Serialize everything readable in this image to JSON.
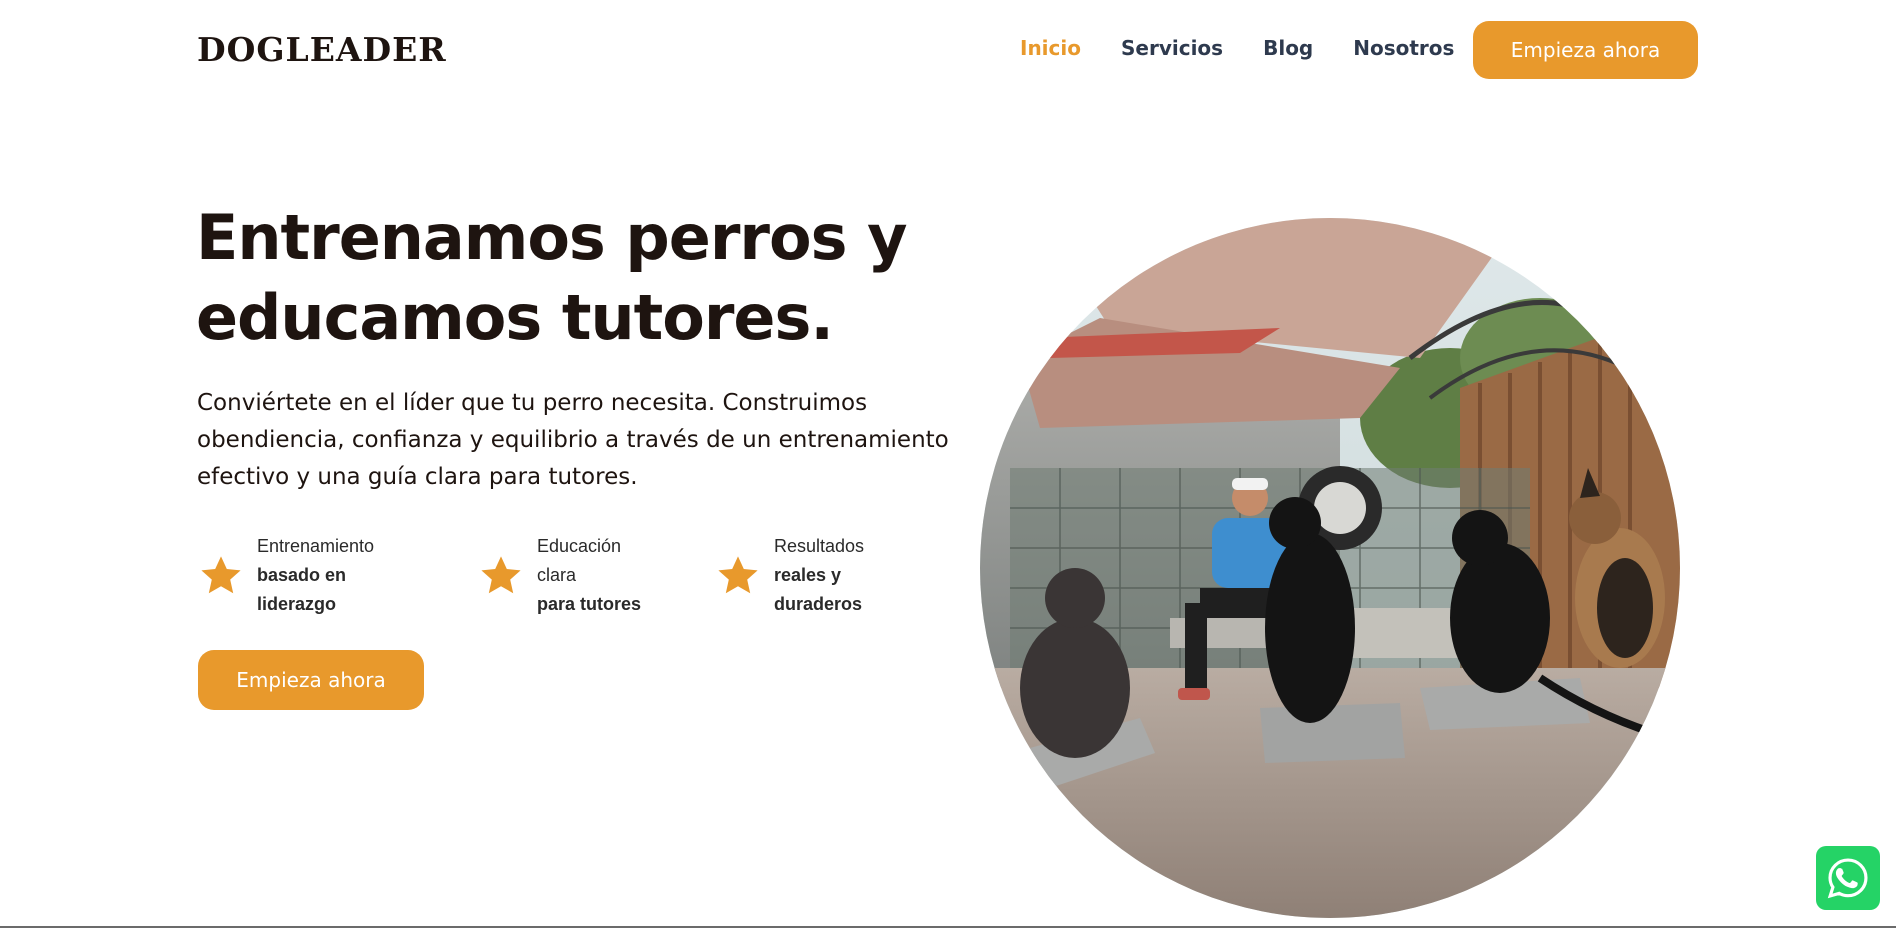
{
  "brand": {
    "logo": "DOGLEADER"
  },
  "nav": {
    "items": [
      {
        "label": "Inicio",
        "active": true
      },
      {
        "label": "Servicios",
        "active": false
      },
      {
        "label": "Blog",
        "active": false
      },
      {
        "label": "Nosotros",
        "active": false
      }
    ],
    "cta_label": "Empieza ahora"
  },
  "hero": {
    "title_line1": "Entrenamos perros y",
    "title_line2": "educamos tutores.",
    "description": "Conviértete en el líder que tu perro necesita. Construimos obendiencia, confianza y equilibrio a través de un entrenamiento efectivo y una guía clara para tutores.",
    "features": [
      {
        "icon": "star-icon",
        "line1": "Entrenamiento",
        "line2": "basado en",
        "line3": "liderazgo"
      },
      {
        "icon": "star-icon",
        "line1": "Educación",
        "line2": "clara",
        "line3": "para tutores"
      },
      {
        "icon": "star-icon",
        "line1": "Resultados",
        "line2": "reales y",
        "line3": "duraderos"
      }
    ],
    "cta_label": "Empieza ahora",
    "image": "circular photo of trainer with four dogs on training platforms"
  },
  "floating": {
    "icon": "whatsapp-icon"
  },
  "colors": {
    "accent": "#e8992c",
    "text_dark": "#1e1410",
    "nav_text": "#2e3a4e",
    "whatsapp": "#25d366"
  }
}
